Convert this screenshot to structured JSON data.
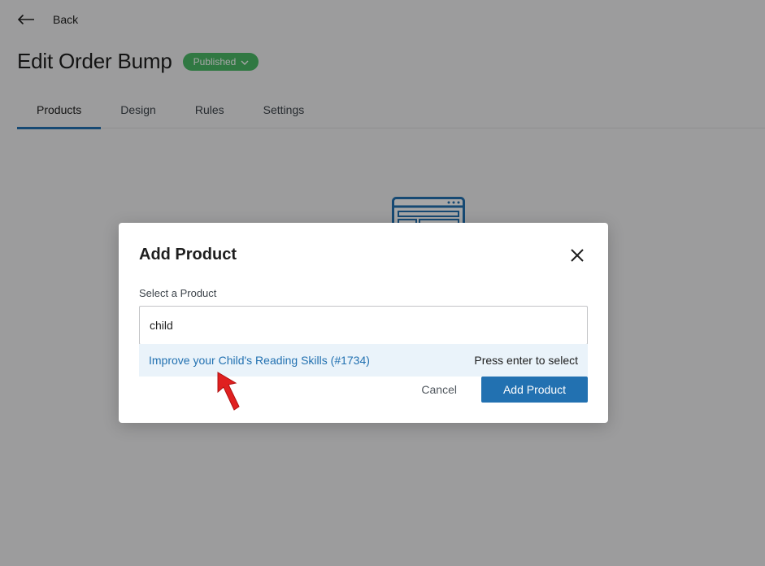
{
  "header": {
    "back_label": "Back",
    "title": "Edit Order Bump",
    "status": "Published"
  },
  "tabs": [
    {
      "label": "Products",
      "active": true
    },
    {
      "label": "Design",
      "active": false
    },
    {
      "label": "Rules",
      "active": false
    },
    {
      "label": "Settings",
      "active": false
    }
  ],
  "modal": {
    "title": "Add Product",
    "field_label": "Select a Product",
    "search_value": "child",
    "suggestion": {
      "label": "Improve your Child's Reading Skills (#1734)",
      "hint": "Press enter to select"
    },
    "cancel_label": "Cancel",
    "add_label": "Add Product"
  },
  "colors": {
    "accent": "#2271b1",
    "status_green": "#4ab866",
    "annotation_red": "#e02020"
  },
  "icons": {
    "back": "arrow-left-icon",
    "status_caret": "chevron-down-icon",
    "close": "close-icon",
    "empty_state": "browser-window-icon",
    "annotation": "red-pointer-arrow-icon"
  }
}
